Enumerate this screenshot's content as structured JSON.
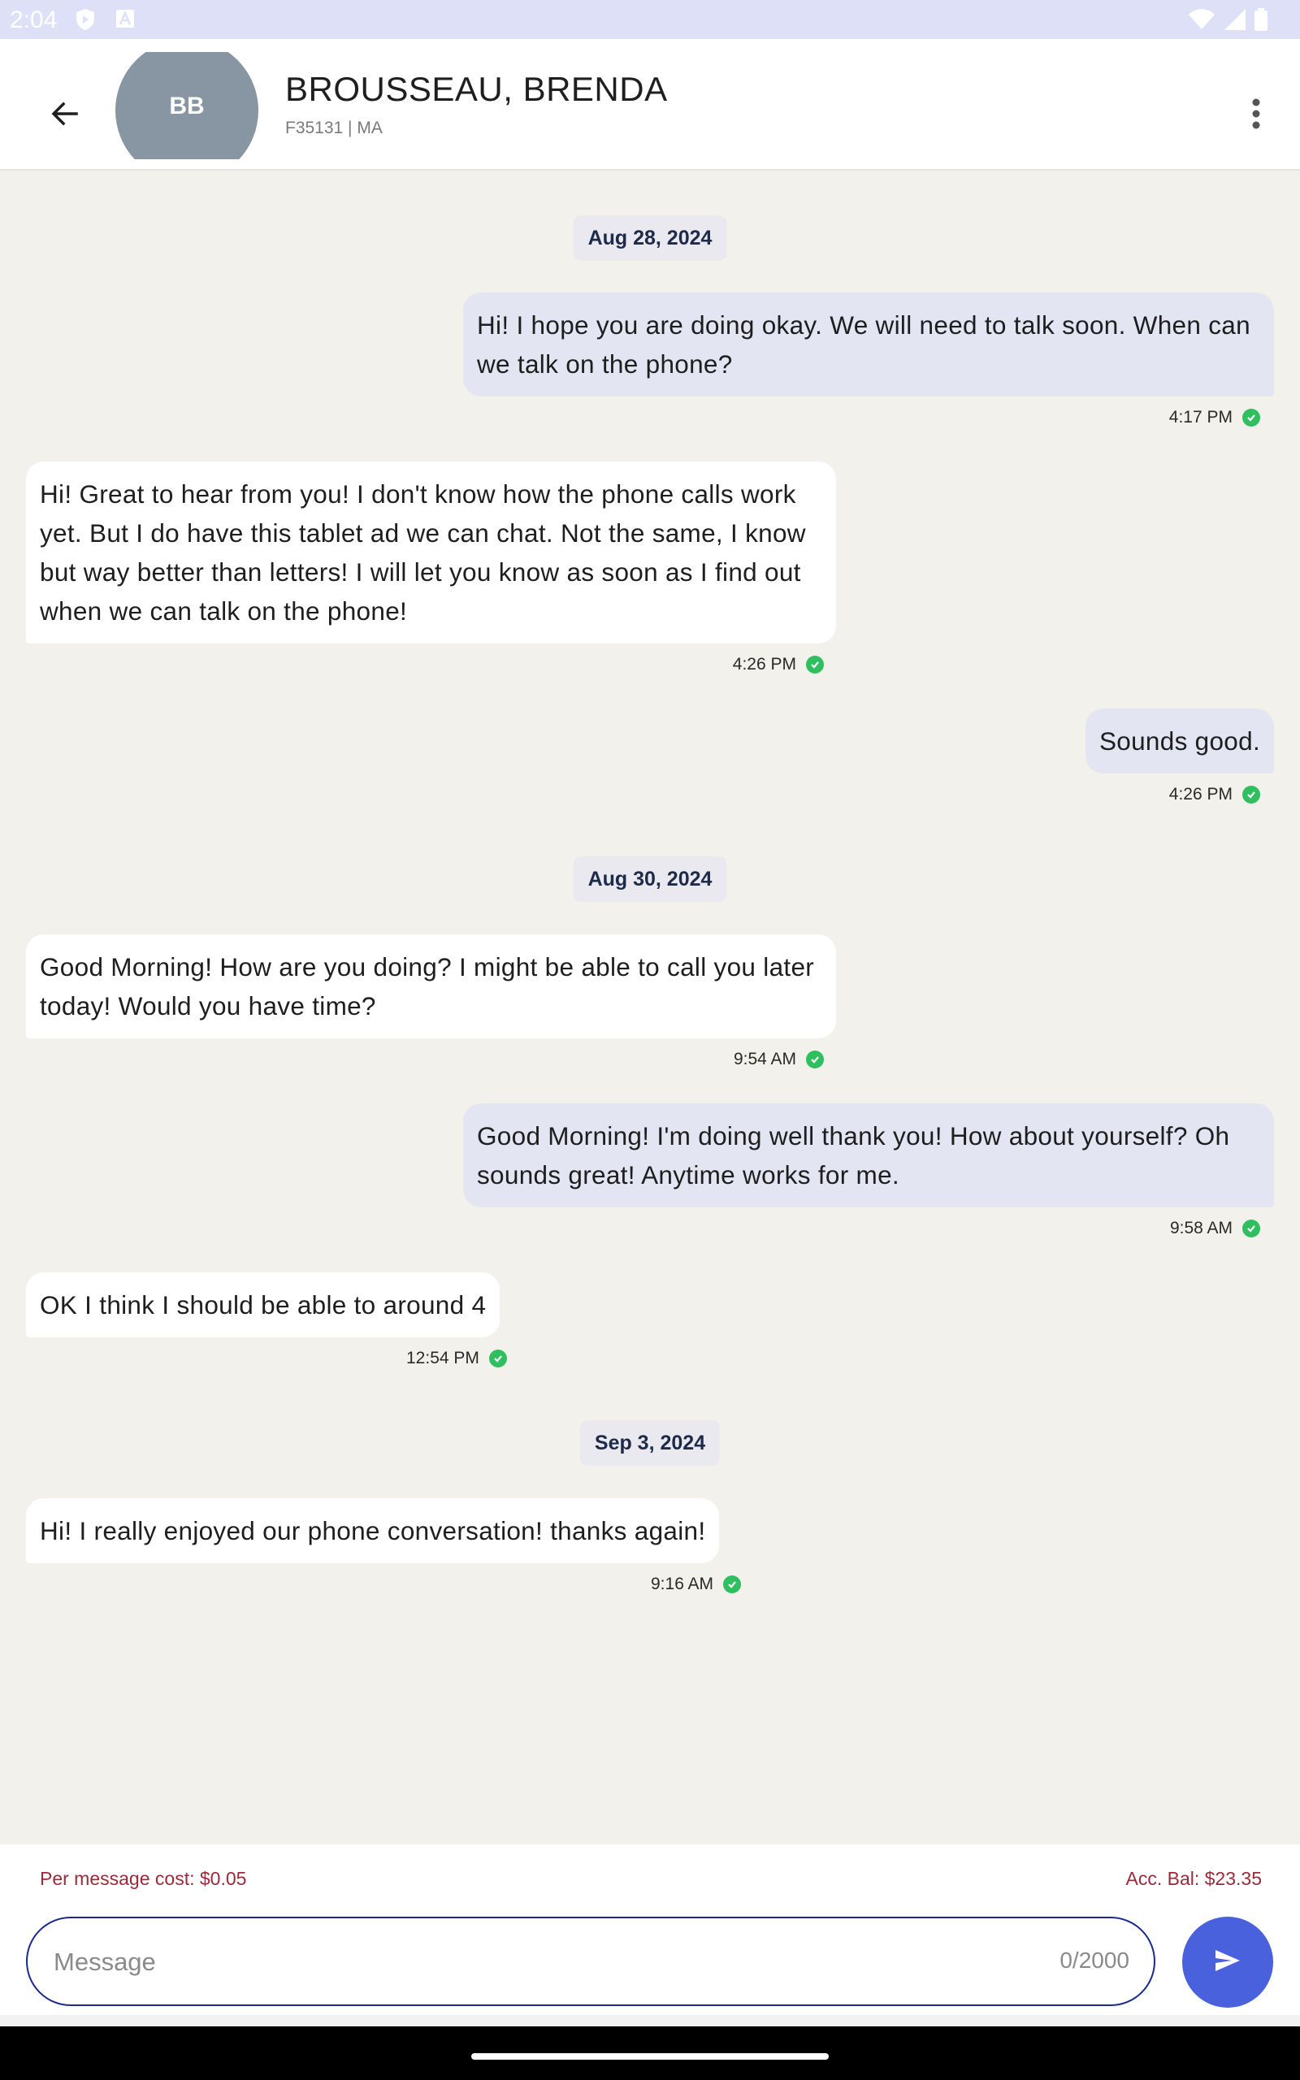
{
  "status_bar": {
    "time": "2:04",
    "icons": [
      "shield-icon",
      "a-icon",
      "wifi-icon",
      "signal-icon",
      "battery-icon"
    ]
  },
  "header": {
    "avatar_initials": "BB",
    "contact_name": "BROUSSEAU, BRENDA",
    "contact_sub": "F35131 | MA",
    "icons": [
      "back-arrow-icon",
      "more-vert-icon"
    ]
  },
  "conversation": {
    "dates": [
      "Aug 28, 2024",
      "Aug 30, 2024",
      "Sep 3, 2024"
    ],
    "messages": [
      {
        "direction": "outgoing",
        "text": "Hi! I hope you are doing okay. We will need to talk soon. When can we talk on the phone?",
        "time": "4:17 PM",
        "status": "delivered"
      },
      {
        "direction": "incoming",
        "text": "Hi! Great to hear from you! I don't know how the phone calls work yet. But I do have this tablet ad we can chat. Not the same, I know but way better than letters! I will let you know as soon as I find out when we can talk on the phone!",
        "time": "4:26 PM",
        "status": "delivered"
      },
      {
        "direction": "outgoing",
        "text": "Sounds good.",
        "time": "4:26 PM",
        "status": "delivered"
      },
      {
        "direction": "incoming",
        "text": "Good Morning! How are you doing? I might be able to call you later today! Would you have time?",
        "time": "9:54 AM",
        "status": "delivered"
      },
      {
        "direction": "outgoing",
        "text": "Good Morning! I'm doing well thank you! How about yourself? Oh sounds great! Anytime works for me.",
        "time": "9:58 AM",
        "status": "delivered"
      },
      {
        "direction": "incoming",
        "text": "OK I think I should be able to around 4",
        "time": "12:54 PM",
        "status": "delivered"
      },
      {
        "direction": "incoming",
        "text": "Hi! I really enjoyed our phone conversation! thanks again!",
        "time": "9:16 AM",
        "status": "delivered"
      }
    ]
  },
  "footer": {
    "cost_label": "Per message cost: $0.05",
    "balance_label": "Acc. Bal: $23.35",
    "message_placeholder": "Message",
    "char_count": "0/2000",
    "send_icon": "send-icon"
  },
  "colors": {
    "background": "#f3f1ec",
    "outgoing_bubble": "#e3e5f3",
    "incoming_bubble": "#ffffff",
    "delivered_check": "#2fbf5f",
    "send_button": "#4a61de",
    "input_border": "#1b2a8f",
    "cost_text": "#9b2a3a",
    "avatar_bg": "#8796a2",
    "status_bar": "#dde0f6"
  }
}
